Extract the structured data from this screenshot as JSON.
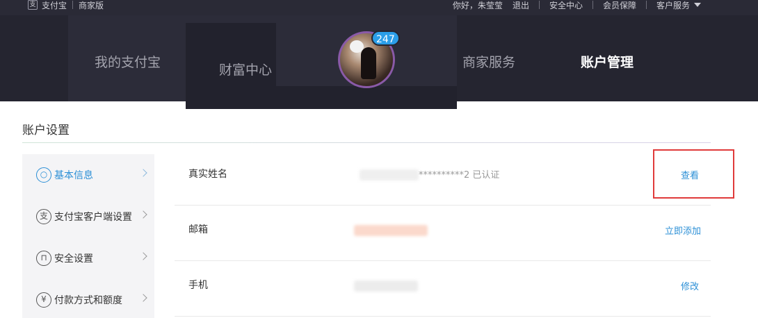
{
  "topbar": {
    "logo_icon": "alipay-logo-icon",
    "brand": "支付宝",
    "edition": "商家版",
    "greeting": "你好，朱莹莹",
    "logout": "退出",
    "security_center": "安全中心",
    "member_protection": "会员保障",
    "customer_service": "客户服务"
  },
  "nav": {
    "items": [
      {
        "label": "我的支付宝"
      },
      {
        "label": "财富中心"
      },
      {
        "label": "商家服务"
      },
      {
        "label": "账户管理",
        "active": true
      }
    ],
    "avatar_badge": "247"
  },
  "page": {
    "title": "账户设置"
  },
  "sidebar": {
    "items": [
      {
        "label": "基本信息",
        "icon": "user-icon",
        "glyph": "○",
        "active": true
      },
      {
        "label": "支付宝客户端设置",
        "icon": "alipay-icon",
        "glyph": "支"
      },
      {
        "label": "安全设置",
        "icon": "lock-icon",
        "glyph": "⊓"
      },
      {
        "label": "付款方式和额度",
        "icon": "yuan-icon",
        "glyph": "¥"
      }
    ]
  },
  "rows": [
    {
      "label": "真实姓名",
      "value": "**********2 已认证",
      "action": "查看"
    },
    {
      "label": "邮箱",
      "value": "",
      "action": "立即添加"
    },
    {
      "label": "手机",
      "value": "",
      "action": "修改"
    }
  ],
  "colors": {
    "accent": "#2b8fd6",
    "badge": "#2b9ee8",
    "highlight": "#e03a3a",
    "nav_bg": "#252530"
  }
}
